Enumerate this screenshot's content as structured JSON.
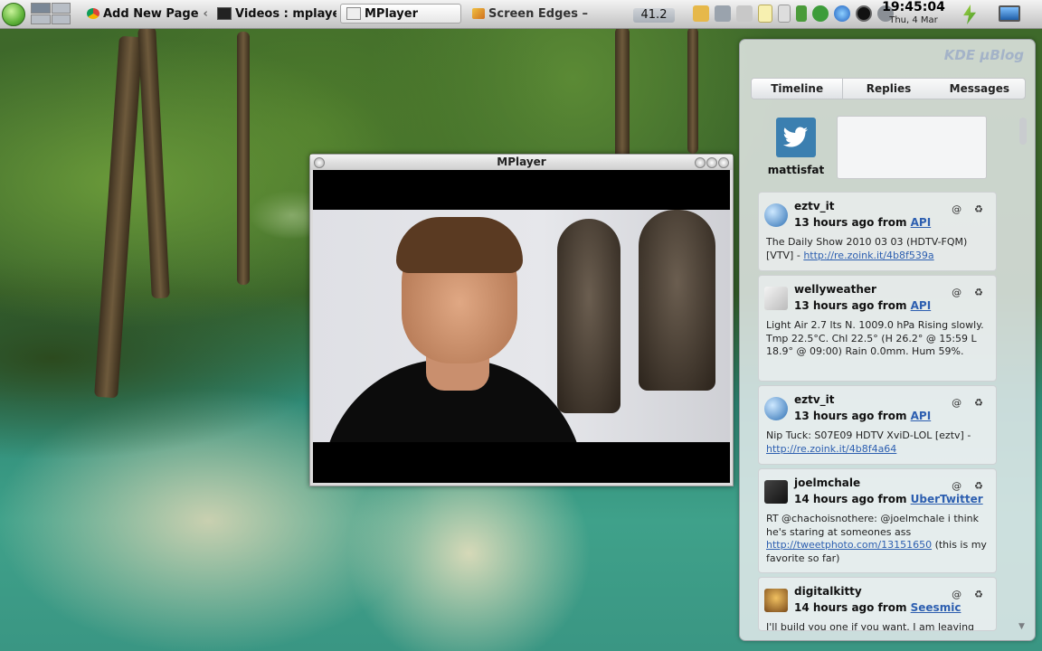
{
  "taskbar": {
    "tasks": [
      {
        "label": "Add New Page",
        "suffix": "‹"
      },
      {
        "label": "Videos : mplayer",
        "suffix": ""
      },
      {
        "label": "MPlayer",
        "suffix": ""
      },
      {
        "label": "Screen Edges – S",
        "suffix": ""
      }
    ],
    "temperature": "41.2",
    "clock_time": "19:45:04",
    "clock_date": "Thu, 4 Mar",
    "icons": [
      "kde-menu-icon",
      "pager",
      "chrome-icon",
      "tray-icon",
      "mail-icon",
      "volume-icon",
      "clipboard-icon",
      "battery-icon",
      "network-icon",
      "update-icon",
      "browser-icon",
      "stop-icon",
      "info-icon",
      "power-icon",
      "display-icon"
    ]
  },
  "mplayer": {
    "title": "MPlayer"
  },
  "microblog": {
    "logo": "KDE μBlog",
    "tabs": [
      "Timeline",
      "Replies",
      "Messages"
    ],
    "username": "mattisfat",
    "posts": [
      {
        "user": "eztv_it",
        "time": "13 hours ago from",
        "source": "API",
        "text": "The Daily Show 2010 03 03 (HDTV-FQM) [VTV] -",
        "link": "http://re.zoink.it/4b8f539a",
        "text_after": ""
      },
      {
        "user": "wellyweather",
        "time": "13 hours ago from",
        "source": "API",
        "text": "Light Air 2.7 lts N. 1009.0 hPa Rising slowly. Tmp 22.5°C. Chl 22.5° (H 26.2° @ 15:59 L 18.9° @ 09:00) Rain 0.0mm. Hum 59%.",
        "link": "",
        "text_after": ""
      },
      {
        "user": "eztv_it",
        "time": "13 hours ago from",
        "source": "API",
        "text": "Nip Tuck: S07E09 HDTV XviD-LOL [eztv] -",
        "link": "http://re.zoink.it/4b8f4a64",
        "text_after": ""
      },
      {
        "user": "joelmchale",
        "time": "14 hours ago from",
        "source": "UberTwitter",
        "text": "RT @chachoisnothere: @joelmchale i think he's staring at someones ass",
        "link": "http://tweetphoto.com/13151650",
        "text_after": " (this is my favorite so far)"
      },
      {
        "user": "digitalkitty",
        "time": "14 hours ago from",
        "source": "Seesmic",
        "text": "I'll build you one if you want. I am leaving",
        "link": "",
        "text_after": ""
      }
    ],
    "reply_icon": "@",
    "retweet_icon": "♻"
  }
}
